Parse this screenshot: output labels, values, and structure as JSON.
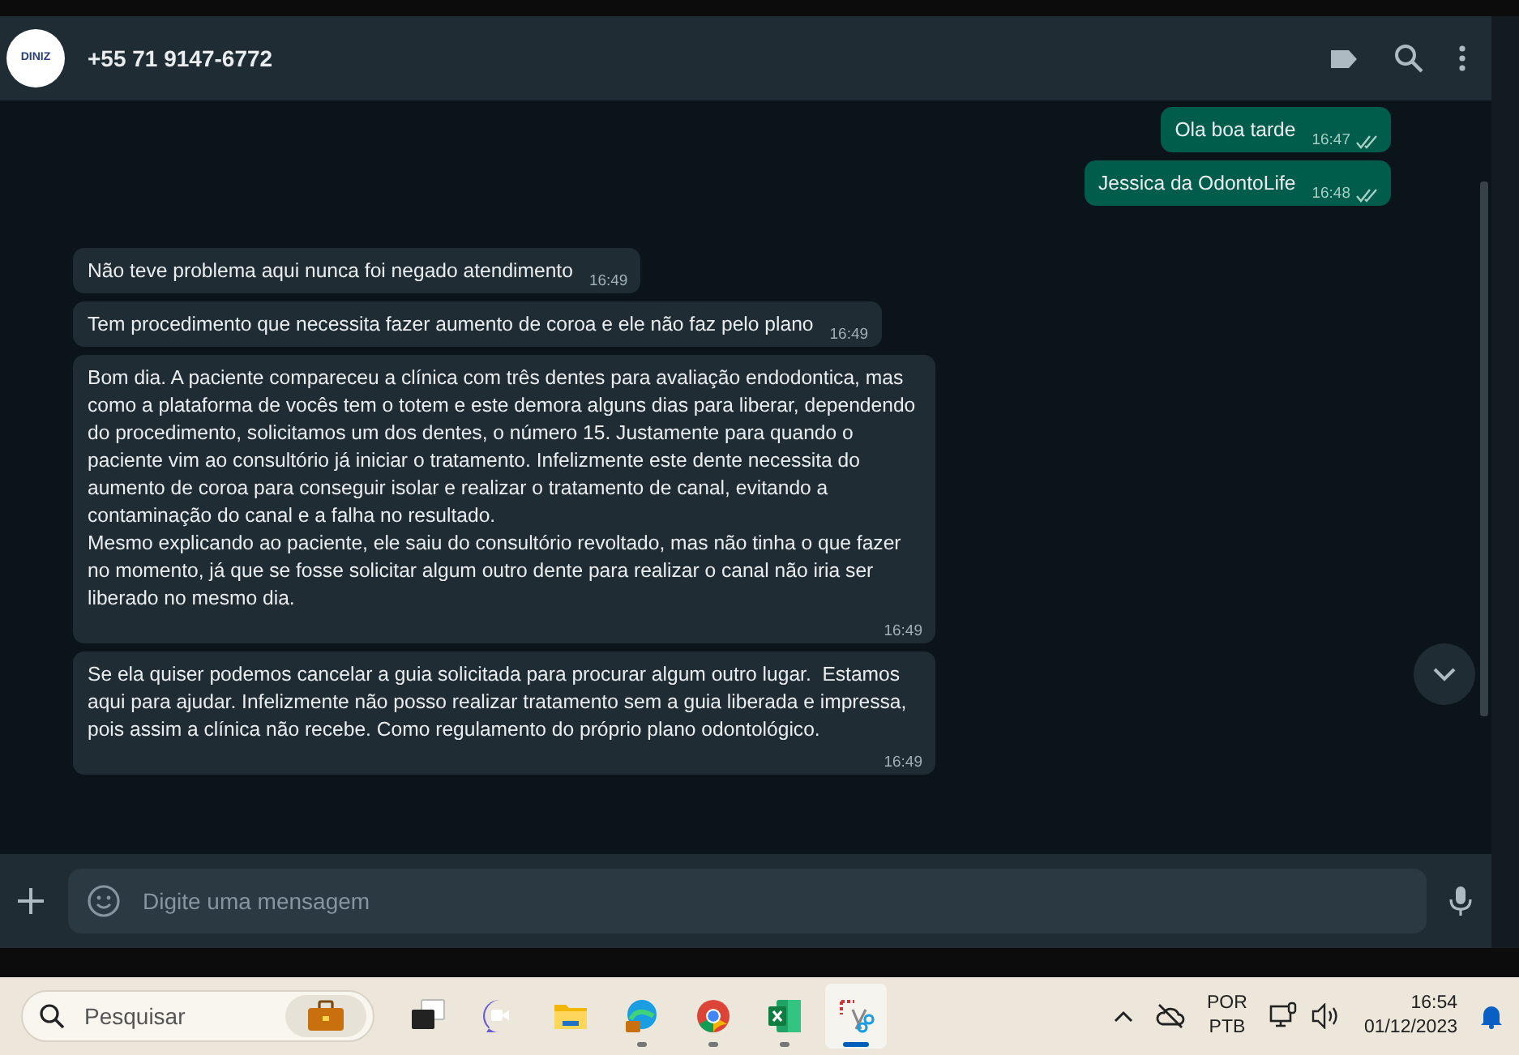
{
  "header": {
    "avatar_text": "DINIZ",
    "contact": "+55 71 9147-6772"
  },
  "messages": [
    {
      "outgoing": true,
      "text": "Ola boa tarde",
      "time": "16:47",
      "read": false
    },
    {
      "outgoing": true,
      "text": "Jessica da OdontoLife",
      "time": "16:48",
      "read": false
    },
    {
      "outgoing": false,
      "text": "Não teve problema aqui nunca foi negado atendimento",
      "time": "16:49"
    },
    {
      "outgoing": false,
      "text": "Tem procedimento que necessita fazer aumento de coroa e ele não faz pelo plano",
      "time": "16:49"
    },
    {
      "outgoing": false,
      "text": "Bom dia. A paciente compareceu a clínica com três dentes para avaliação endodontica, mas como a plataforma de vocês tem o totem e este demora alguns dias para liberar, dependendo do procedimento, solicitamos um dos dentes, o número 15. Justamente para quando o paciente vim ao consultório já iniciar o tratamento. Infelizmente este dente necessita do aumento de coroa para conseguir isolar e realizar o tratamento de canal, evitando a contaminação do canal e a falha no resultado.\nMesmo explicando ao paciente, ele saiu do consultório revoltado, mas não tinha o que fazer no momento, já que se fosse solicitar algum outro dente para realizar o canal não iria ser liberado no mesmo dia.",
      "time": "16:49"
    },
    {
      "outgoing": false,
      "text": "Se ela quiser podemos cancelar a guia solicitada para procurar algum outro lugar.  Estamos aqui para ajudar. Infelizmente não posso realizar tratamento sem a guia liberada e impressa, pois assim a clínica não recebe. Como regulamento do próprio plano odontológico.",
      "time": "16:49"
    }
  ],
  "composer": {
    "placeholder": "Digite uma mensagem"
  },
  "taskbar": {
    "search_placeholder": "Pesquisar",
    "apps": [
      {
        "kind": "taskview",
        "running": false,
        "selected": false
      },
      {
        "kind": "meet",
        "running": false,
        "selected": false
      },
      {
        "kind": "folder",
        "running": false,
        "selected": false
      },
      {
        "kind": "edge",
        "running": true,
        "selected": false
      },
      {
        "kind": "chrome",
        "running": true,
        "selected": false
      },
      {
        "kind": "excel",
        "running": true,
        "selected": false
      },
      {
        "kind": "snip",
        "running": true,
        "selected": true
      }
    ],
    "language": [
      "POR",
      "PTB"
    ],
    "time": "16:54",
    "date": "01/12/2023"
  }
}
